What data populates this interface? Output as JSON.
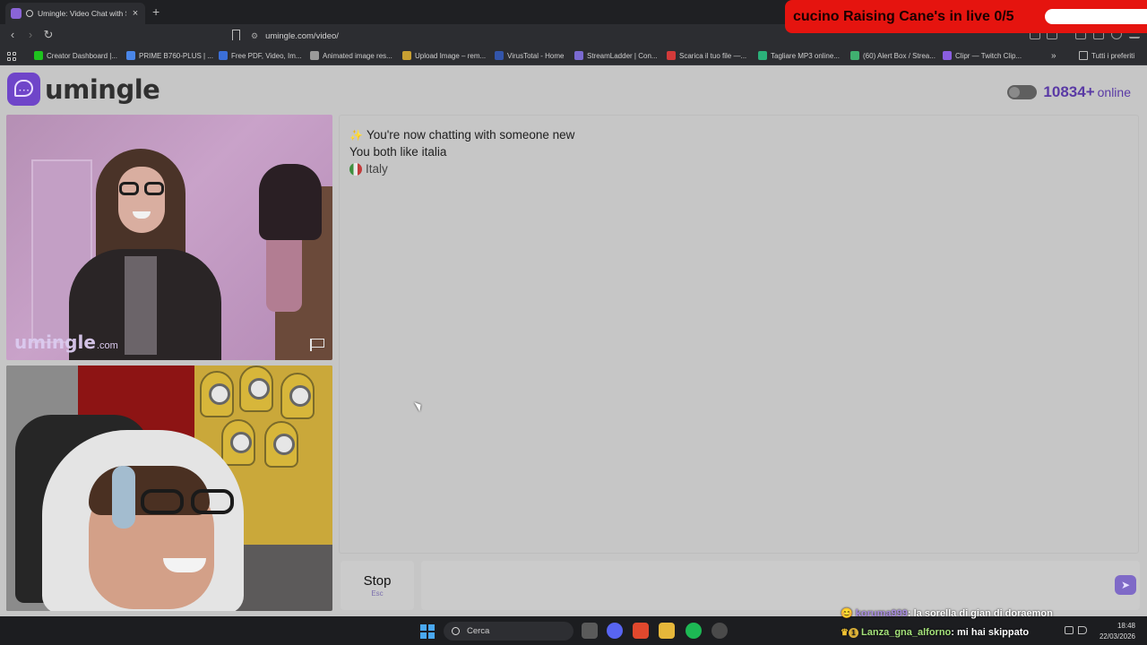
{
  "browser": {
    "tab_title": "Umingle: Video Chat with Str",
    "url": "umingle.com/video/",
    "new_tab": "+",
    "bookmarks": [
      {
        "label": "Creator Dashboard |...",
        "color": "#1ec21e"
      },
      {
        "label": "PRIME B760-PLUS | ...",
        "color": "#4a86e8"
      },
      {
        "label": "Free PDF, Video, Im...",
        "color": "#3b6fd8"
      },
      {
        "label": "Animated image res...",
        "color": "#9a9a9a"
      },
      {
        "label": "Upload Image – rem...",
        "color": "#c9a032"
      },
      {
        "label": "VirusTotal - Home",
        "color": "#3355aa"
      },
      {
        "label": "StreamLadder | Con...",
        "color": "#7a6ad0"
      },
      {
        "label": "Scarica il tuo file —...",
        "color": "#d23a3a"
      },
      {
        "label": "Tagliare MP3 online...",
        "color": "#2bb07a"
      },
      {
        "label": "(60) Alert Box / Strea...",
        "color": "#40b070"
      },
      {
        "label": "Clipr — Twitch Clip...",
        "color": "#8a5ee0"
      }
    ],
    "all_bookmarks": "Tutti i preferiti"
  },
  "overlay": {
    "banner_text": "cucino Raising Cane's in live 0/5"
  },
  "site": {
    "logo_text": "umingle",
    "online_count": "10834+",
    "online_label": "online",
    "watermark_main": "umingle",
    "watermark_sub": ".com"
  },
  "chat": {
    "new_partner": "You're now chatting with someone new",
    "common_interest": "You both like italia",
    "country": "Italy"
  },
  "controls": {
    "stop_label": "Stop",
    "stop_hint": "Esc"
  },
  "taskbar": {
    "search_label": "Cerca",
    "time": "18:48",
    "date": "22/03/2026"
  },
  "stream_chat": [
    {
      "user": "koruma999",
      "message": "la sorella di gian di doraemon"
    },
    {
      "user": "Lanza_gna_alforno",
      "message": "mi hai skippato"
    }
  ]
}
